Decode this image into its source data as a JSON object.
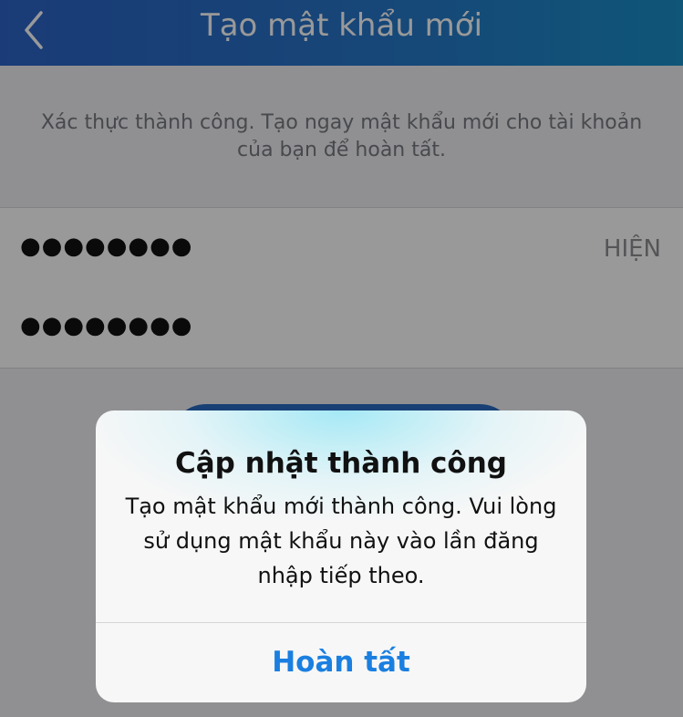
{
  "navbar": {
    "title": "Tạo mật khẩu mới",
    "back_icon": "chevron-left-icon"
  },
  "intro": {
    "text": "Xác thực thành công. Tạo ngay mật khẩu mới cho tài khoản của bạn để hoàn tất."
  },
  "password_field": {
    "value": "●●●●●●●●",
    "show_label": "HIỆN"
  },
  "confirm_field": {
    "value": "●●●●●●●●"
  },
  "alert": {
    "title": "Cập nhật thành công",
    "message": "Tạo mật khẩu mới thành công. Vui lòng sử dụng mật khẩu này vào lần đăng nhập tiếp theo.",
    "button": "Hoàn tất"
  },
  "colors": {
    "nav": "#2c63c6",
    "accent": "#1a7fe0",
    "button": "#2b6cc4"
  }
}
